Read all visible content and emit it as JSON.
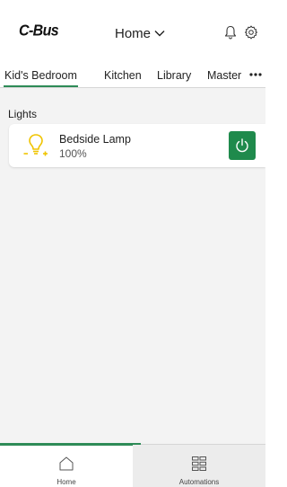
{
  "header": {
    "logo": "C-Bus",
    "location": "Home",
    "icons": [
      "chevron-down-icon",
      "bell-icon",
      "gear-icon"
    ]
  },
  "tabs": [
    {
      "label": "Kid's Bedroom",
      "active": true
    },
    {
      "label": "Kitchen",
      "active": false
    },
    {
      "label": "Library",
      "active": false
    },
    {
      "label": "Master",
      "active": false
    }
  ],
  "more_icon": "more-dots-icon",
  "section": {
    "title": "Lights",
    "devices": [
      {
        "name": "Bedside Lamp",
        "level": "100%",
        "icon": "lightbulb-icon",
        "power_icon": "power-icon"
      }
    ]
  },
  "bottom_nav": {
    "items": [
      {
        "label": "Home",
        "icon": "home-icon",
        "active": true
      },
      {
        "label": "Automations",
        "icon": "grid-icon",
        "active": false
      }
    ]
  },
  "colors": {
    "accent": "#2e8b57",
    "power_button": "#1f8a4c",
    "bulb": "#f0c400"
  }
}
